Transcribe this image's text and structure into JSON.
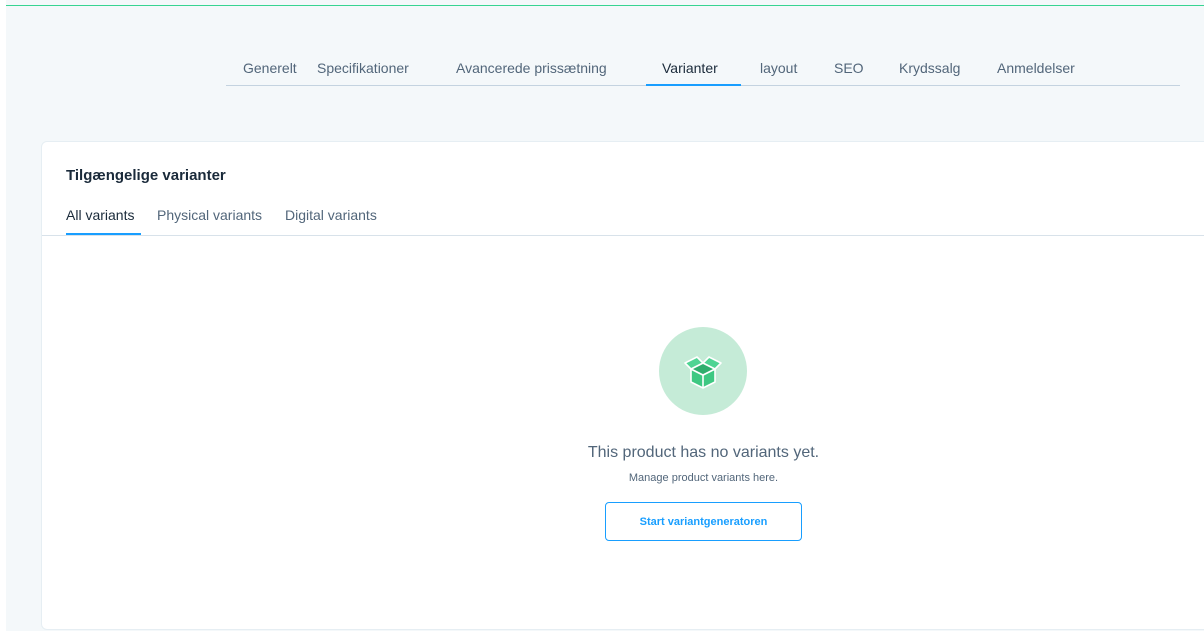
{
  "tabs": {
    "items": [
      {
        "label": "Generelt"
      },
      {
        "label": "Specifikationer"
      },
      {
        "label": "Avancerede prissætning"
      },
      {
        "label": "Varianter"
      },
      {
        "label": "layout"
      },
      {
        "label": "SEO"
      },
      {
        "label": "Krydssalg"
      },
      {
        "label": "Anmeldelser"
      }
    ],
    "active": "Varianter"
  },
  "card": {
    "title": "Tilgængelige varianter",
    "subtabs": [
      {
        "label": "All variants"
      },
      {
        "label": "Physical variants"
      },
      {
        "label": "Digital variants"
      }
    ],
    "active_subtab": "All variants"
  },
  "empty_state": {
    "icon": "open-box-icon",
    "title": "This product has no variants yet.",
    "subtitle": "Manage product variants here.",
    "button_label": "Start variantgeneratoren"
  },
  "colors": {
    "accent": "#189eff",
    "top_border": "#37d492",
    "icon_bg": "#c5ebd7",
    "icon_fg": "#37c87e"
  }
}
